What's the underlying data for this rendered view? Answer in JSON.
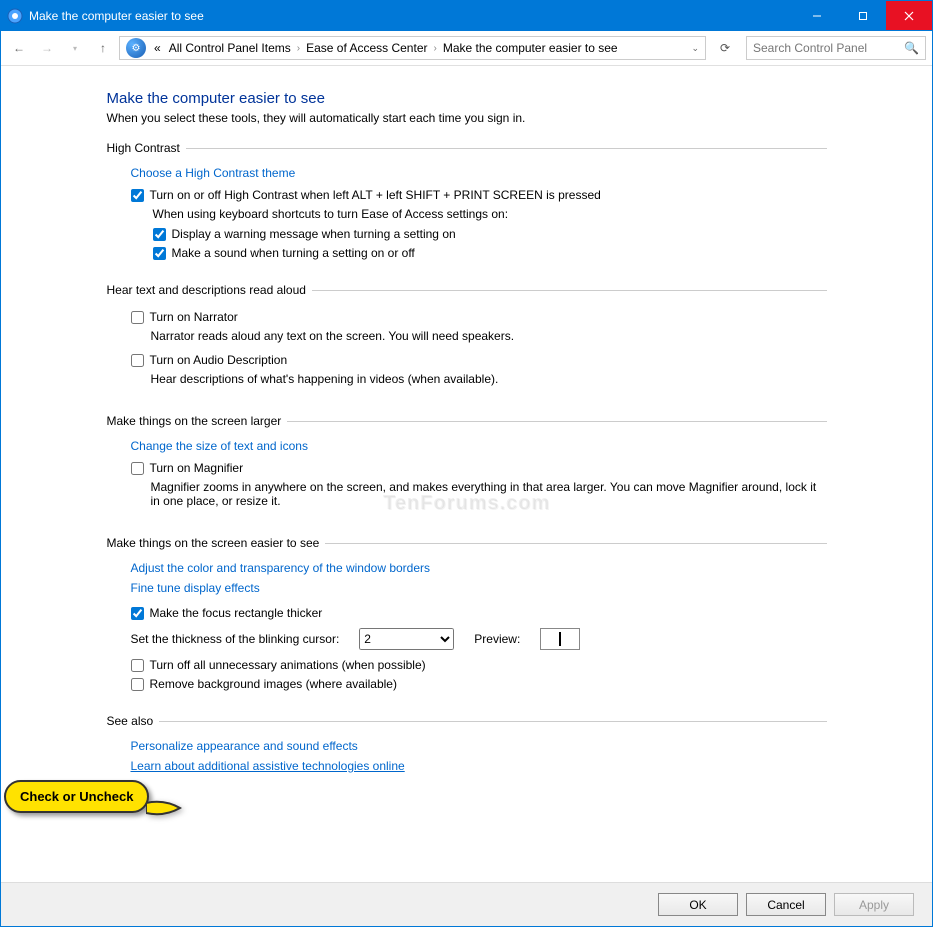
{
  "titlebar": {
    "title": "Make the computer easier to see"
  },
  "breadcrumb": {
    "prefix": "«",
    "items": [
      "All Control Panel Items",
      "Ease of Access Center",
      "Make the computer easier to see"
    ]
  },
  "search": {
    "placeholder": "Search Control Panel"
  },
  "page": {
    "title": "Make the computer easier to see",
    "desc": "When you select these tools, they will automatically start each time you sign in."
  },
  "highContrast": {
    "legend": "High Contrast",
    "chooseTheme": "Choose a High Contrast theme",
    "toggleHC": "Turn on or off High Contrast when left ALT + left SHIFT + PRINT SCREEN is pressed",
    "whenShortcut": "When using keyboard shortcuts to turn Ease of Access settings on:",
    "warning": "Display a warning message when turning a setting on",
    "sound": "Make a sound when turning a setting on or off"
  },
  "hearText": {
    "legend": "Hear text and descriptions read aloud",
    "narrator": "Turn on Narrator",
    "narratorHelp": "Narrator reads aloud any text on the screen. You will need speakers.",
    "audioDesc": "Turn on Audio Description",
    "audioHelp": "Hear descriptions of what's happening in videos (when available)."
  },
  "larger": {
    "legend": "Make things on the screen larger",
    "changeSize": "Change the size of text and icons",
    "magnifier": "Turn on Magnifier",
    "magHelp": "Magnifier zooms in anywhere on the screen, and makes everything in that area larger. You can move Magnifier around, lock it in one place, or resize it."
  },
  "easier": {
    "legend": "Make things on the screen easier to see",
    "adjustColor": "Adjust the color and transparency of the window borders",
    "fineTune": "Fine tune display effects",
    "focusRect": "Make the focus rectangle thicker",
    "cursorLabel": "Set the thickness of the blinking cursor:",
    "cursorValue": "2",
    "previewLabel": "Preview:",
    "turnOffAnim": "Turn off all unnecessary animations (when possible)",
    "removeBg": "Remove background images (where available)"
  },
  "seeAlso": {
    "legend": "See also",
    "personalize": "Personalize appearance and sound effects",
    "learn": "Learn about additional assistive technologies online"
  },
  "checked": {
    "toggleHC": true,
    "warning": true,
    "sound": true,
    "narrator": false,
    "audioDesc": false,
    "magnifier": false,
    "focusRect": true,
    "turnOffAnim": false,
    "removeBg": false
  },
  "buttons": {
    "ok": "OK",
    "cancel": "Cancel",
    "apply": "Apply"
  },
  "callout": "Check or Uncheck",
  "watermark": "TenForums.com"
}
